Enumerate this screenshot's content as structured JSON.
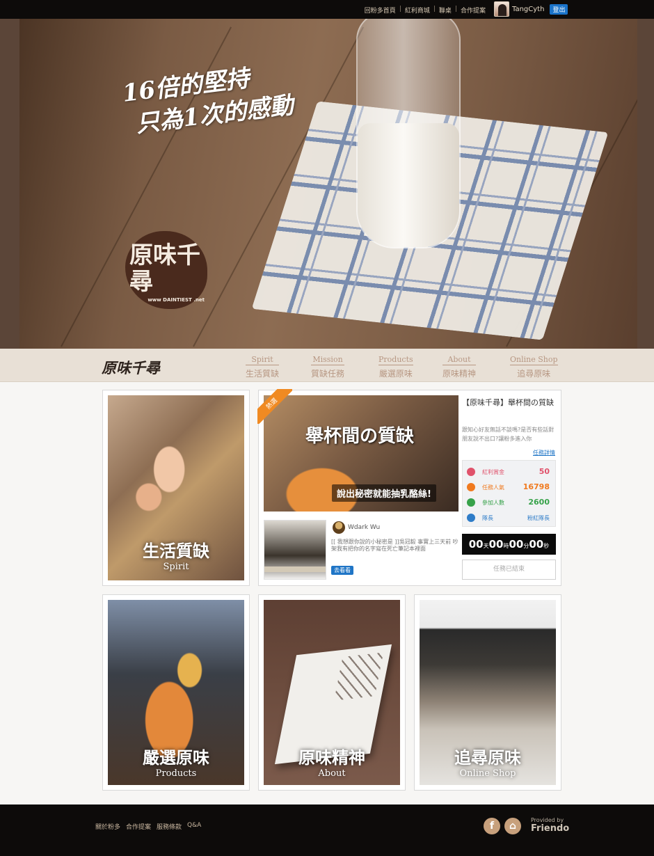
{
  "topbar": {
    "links": [
      "回粉多首頁",
      "紅利商城",
      "聯桌",
      "合作提案"
    ],
    "username": "TangCyth",
    "logout": "登出"
  },
  "hero": {
    "line1": "16倍的堅持",
    "line2": "只為1次的感動",
    "logo_text": "原味千尋",
    "logo_url": "www DAINTIEST .net"
  },
  "nav": {
    "brand": "原味千尋",
    "items": [
      {
        "en": "Spirit",
        "zh": "生活質缺"
      },
      {
        "en": "Mission",
        "zh": "質缺任務"
      },
      {
        "en": "Products",
        "zh": "嚴選原味"
      },
      {
        "en": "About",
        "zh": "原味精神"
      },
      {
        "en": "Online Shop",
        "zh": "追尋原味"
      }
    ]
  },
  "spirit_card": {
    "zh": "生活質缺",
    "en": "Spirit"
  },
  "mission": {
    "ribbon": "熱選",
    "promo_headline": "舉杯間の質缺",
    "promo_sub": "說出秘密就能抽乳酪絲!",
    "title": "【原味千尋】舉杯間の質缺",
    "desc": "跟知心好友無話不談嗎?是否有些話對朋友說不出口?讓粉多進入你",
    "detail_link": "任務詳情",
    "stats": [
      {
        "label": "紅利賞金",
        "value": "50",
        "color": "#e0526b"
      },
      {
        "label": "任務人氣",
        "value": "16798",
        "color": "#f07a1f"
      },
      {
        "label": "參加人數",
        "value": "2600",
        "color": "#37a24a"
      },
      {
        "label": "隊長",
        "value": "粉紅隊長",
        "color": "#2e7cc8"
      }
    ],
    "countdown": {
      "d": "00",
      "d_unit": "天",
      "h": "00",
      "h_unit": "時",
      "m": "00",
      "m_unit": "分",
      "s": "00",
      "s_unit": "秒"
    },
    "ended": "任務已結束",
    "feed": {
      "user": "Wdark Wu",
      "text": "[[ 我想跟你說的小秘密是 ]]吳冠毅 事實上三天前 吵架我有把你的名字寫在死亡筆記本裡面",
      "button": "去看看"
    }
  },
  "cards": [
    {
      "zh": "嚴選原味",
      "en": "Products"
    },
    {
      "zh": "原味精神",
      "en": "About"
    },
    {
      "zh": "追尋原味",
      "en": "Online Shop"
    }
  ],
  "footer": {
    "links": [
      "關於粉多",
      "合作提案",
      "服務條款",
      "Q&A"
    ],
    "provided_by": "Provided by",
    "brand": "Friendo"
  },
  "colors": {
    "accent": "#f08a22",
    "link": "#1f75c6",
    "nav_text": "#b79783"
  }
}
